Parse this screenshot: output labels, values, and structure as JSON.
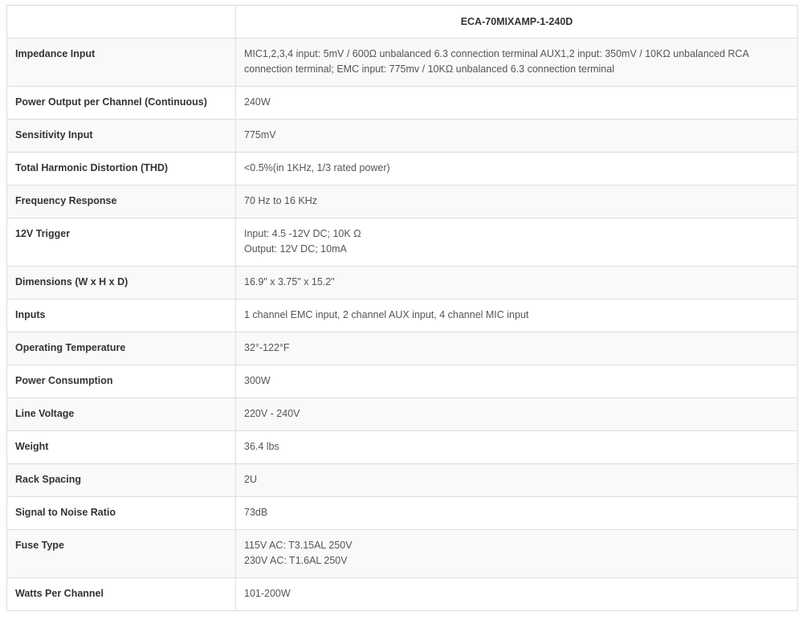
{
  "table": {
    "header": {
      "corner": "",
      "model": "ECA-70MIXAMP-1-240D"
    },
    "rows": [
      {
        "label": "Impedance Input",
        "lines": [
          "MIC1,2,3,4 input: 5mV / 600Ω unbalanced 6.3 connection terminal AUX1,2 input: 350mV / 10KΩ unbalanced RCA connection terminal; EMC input: 775mv / 10KΩ unbalanced 6.3 connection terminal"
        ]
      },
      {
        "label": "Power Output per Channel (Continuous)",
        "lines": [
          "240W"
        ]
      },
      {
        "label": "Sensitivity Input",
        "lines": [
          "775mV"
        ]
      },
      {
        "label": "Total Harmonic Distortion (THD)",
        "lines": [
          "<0.5%(in 1KHz, 1/3 rated power)"
        ]
      },
      {
        "label": "Frequency Response",
        "lines": [
          "70 Hz to 16 KHz"
        ]
      },
      {
        "label": "12V Trigger",
        "lines": [
          "Input: 4.5 -12V DC; 10K Ω",
          "Output: 12V DC; 10mA"
        ]
      },
      {
        "label": "Dimensions (W x H x D)",
        "lines": [
          "16.9\" x 3.75\" x 15.2\""
        ]
      },
      {
        "label": "Inputs",
        "lines": [
          "1 channel EMC input, 2 channel AUX input, 4 channel MIC input"
        ]
      },
      {
        "label": "Operating Temperature",
        "lines": [
          "32°-122°F"
        ]
      },
      {
        "label": "Power Consumption",
        "lines": [
          "300W"
        ]
      },
      {
        "label": "Line Voltage",
        "lines": [
          "220V - 240V"
        ]
      },
      {
        "label": "Weight",
        "lines": [
          "36.4 lbs"
        ]
      },
      {
        "label": "Rack Spacing",
        "lines": [
          "2U"
        ]
      },
      {
        "label": "Signal to Noise Ratio",
        "lines": [
          "73dB"
        ]
      },
      {
        "label": "Fuse Type",
        "lines": [
          "115V AC: T3.15AL 250V",
          "230V AC: T1.6AL 250V"
        ]
      },
      {
        "label": "Watts Per Channel",
        "lines": [
          "101-200W"
        ]
      }
    ]
  }
}
